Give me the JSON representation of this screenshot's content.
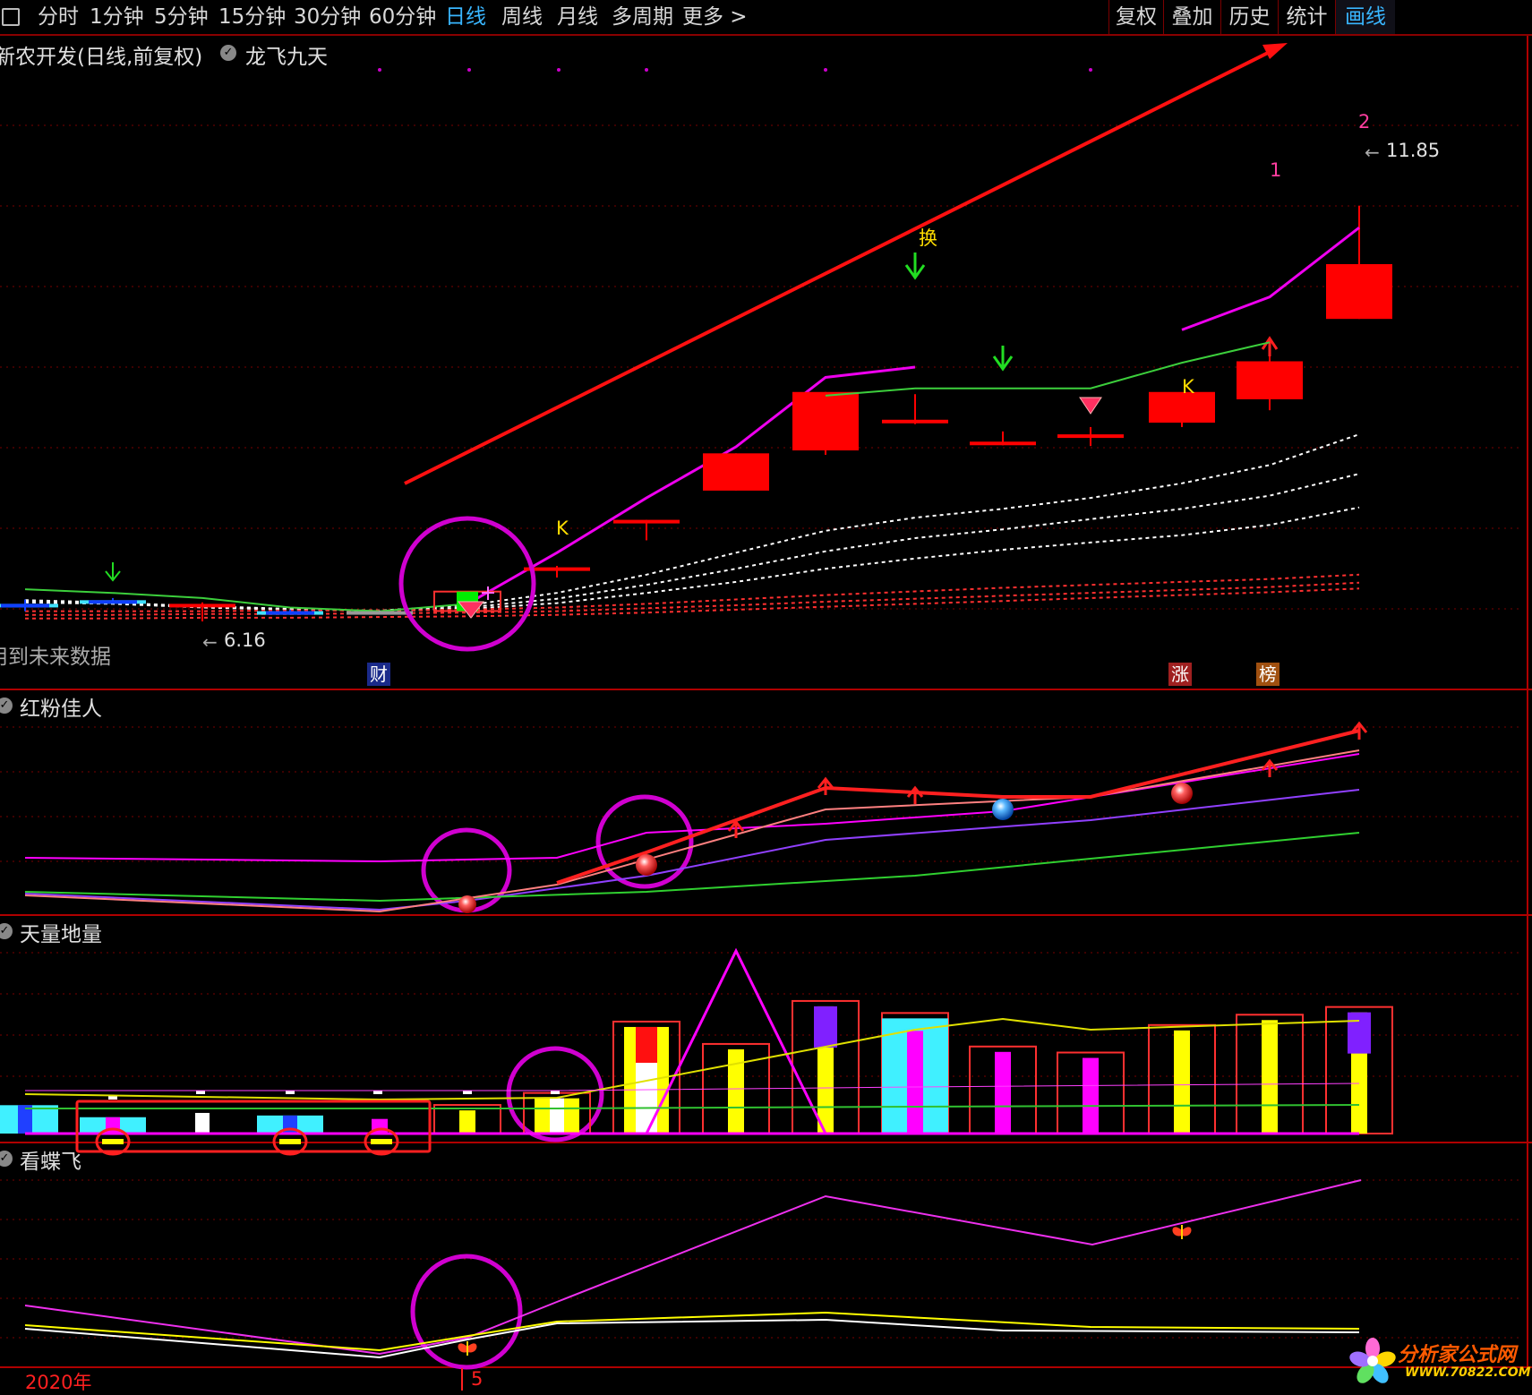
{
  "toolbar": {
    "periods": [
      "分时",
      "1分钟",
      "5分钟",
      "15分钟",
      "30分钟",
      "60分钟",
      "日线",
      "周线",
      "月线",
      "多周期",
      "更多 >"
    ],
    "active_period": "日线",
    "right_buttons": [
      "复权",
      "叠加",
      "历史",
      "统计",
      "画线"
    ],
    "active_right": "画线"
  },
  "main_panel": {
    "title": "新农开发(日线,前复权)",
    "indicator": "龙飞九天",
    "high_label": "11.85",
    "low_label": "6.16",
    "note": "用到未来数据",
    "markers": {
      "k1": "K",
      "k2": "K",
      "huan": "换",
      "n1": "1",
      "n2": "2"
    },
    "badges": {
      "cai": "财",
      "zhang": "涨",
      "bang": "榜"
    }
  },
  "panel2": {
    "title": "红粉佳人"
  },
  "panel3": {
    "title": "天量地量"
  },
  "panel4": {
    "title": "看蝶飞"
  },
  "x_axis": {
    "year_label": "2020年",
    "month_label": "5"
  },
  "watermark": {
    "title": "分析家公式网",
    "url": "WWW.70822.COM"
  },
  "chart_data": {
    "type": "candlestick",
    "candles": [
      {
        "o": 6.4,
        "h": 6.46,
        "l": 6.3,
        "c": 6.4,
        "color": "blue"
      },
      {
        "o": 6.45,
        "h": 6.48,
        "l": 6.4,
        "c": 6.42,
        "color": "blue"
      },
      {
        "o": 6.4,
        "h": 6.42,
        "l": 6.16,
        "c": 6.38,
        "color": "red"
      },
      {
        "o": 6.3,
        "h": 6.32,
        "l": 6.25,
        "c": 6.27,
        "color": "blue"
      },
      {
        "o": 6.3,
        "h": 6.31,
        "l": 6.28,
        "c": 6.3,
        "color": "gray"
      },
      {
        "o": 6.47,
        "h": 6.48,
        "l": 6.4,
        "c": 6.4,
        "color": "green"
      },
      {
        "o": 6.9,
        "h": 6.92,
        "l": 6.76,
        "c": 6.88,
        "color": "red"
      },
      {
        "o": 7.55,
        "h": 7.55,
        "l": 7.27,
        "c": 7.55,
        "color": "red"
      },
      {
        "o": 7.95,
        "h": 8.46,
        "l": 7.95,
        "c": 8.46,
        "color": "red"
      },
      {
        "o": 8.5,
        "h": 9.3,
        "l": 8.44,
        "c": 9.3,
        "color": "red"
      },
      {
        "o": 8.92,
        "h": 9.27,
        "l": 8.86,
        "c": 8.88,
        "color": "red"
      },
      {
        "o": 8.6,
        "h": 8.76,
        "l": 8.57,
        "c": 8.62,
        "color": "red"
      },
      {
        "o": 8.68,
        "h": 8.82,
        "l": 8.56,
        "c": 8.72,
        "color": "red"
      },
      {
        "o": 8.88,
        "h": 9.0,
        "l": 8.82,
        "c": 9.3,
        "color": "red"
      },
      {
        "o": 9.2,
        "h": 10.0,
        "l": 9.05,
        "c": 9.72,
        "color": "red"
      },
      {
        "o": 10.3,
        "h": 11.85,
        "l": 10.3,
        "c": 11.05,
        "color": "red"
      }
    ],
    "volume": [
      3.3,
      1.9,
      2.4,
      2.1,
      1.7,
      2.7,
      4.1,
      12.4,
      9.8,
      14.8,
      13.4,
      9.5,
      8.8,
      12.0,
      13.2,
      14.1
    ]
  }
}
